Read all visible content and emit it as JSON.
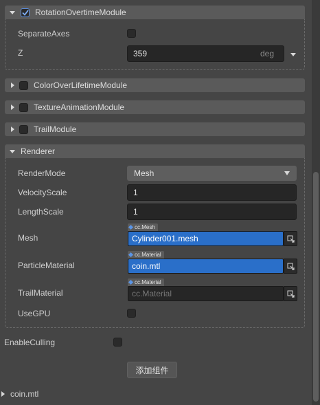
{
  "rotation_module": {
    "title": "RotationOvertimeModule",
    "enabled": true,
    "separate_axes_label": "SeparateAxes",
    "z_label": "Z",
    "z_value": "359",
    "z_unit": "deg"
  },
  "collapsed_modules": [
    {
      "title": "ColorOverLifetimeModule"
    },
    {
      "title": "TextureAnimationModule"
    },
    {
      "title": "TrailModule"
    }
  ],
  "renderer": {
    "title": "Renderer",
    "render_mode_label": "RenderMode",
    "render_mode_value": "Mesh",
    "velocity_scale_label": "VelocityScale",
    "velocity_scale_value": "1",
    "length_scale_label": "LengthScale",
    "length_scale_value": "1",
    "mesh_label": "Mesh",
    "mesh_type": "cc.Mesh",
    "mesh_value": "Cylinder001.mesh",
    "particle_material_label": "ParticleMaterial",
    "particle_material_type": "cc.Material",
    "particle_material_value": "coin.mtl",
    "trail_material_label": "TrailMaterial",
    "trail_material_type": "cc.Material",
    "trail_material_placeholder": "cc.Material",
    "use_gpu_label": "UseGPU"
  },
  "enable_culling_label": "EnableCulling",
  "add_component_label": "添加组件",
  "footer_asset": "coin.mtl",
  "colors": {
    "background": "#454545",
    "header": "#5a5a5a",
    "asset_selected": "#2a6fc9",
    "checkbox_accent": "#5a8ad8"
  }
}
